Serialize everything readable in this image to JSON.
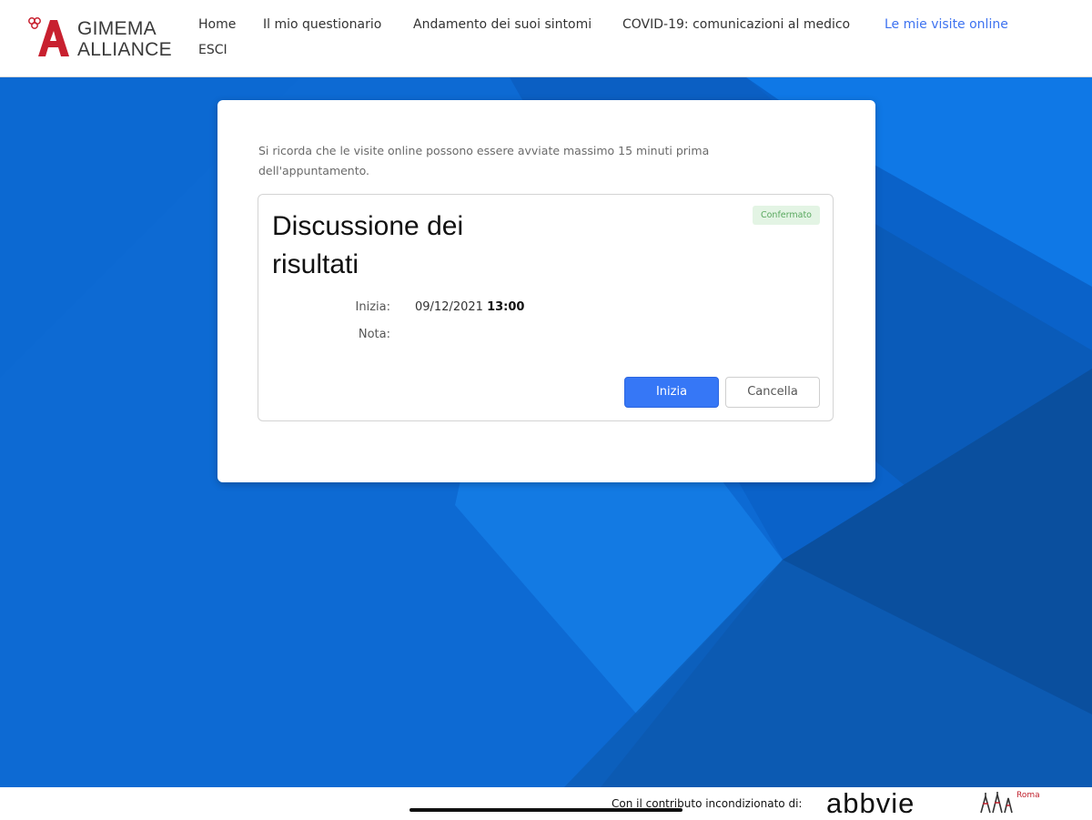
{
  "header": {
    "logo": {
      "line1": "GIMEMA",
      "line2": "ALLIANCE"
    },
    "nav": [
      {
        "label": "Home"
      },
      {
        "label": "Il mio questionario"
      },
      {
        "label": "Andamento dei suoi sintomi"
      },
      {
        "label": "COVID-19: comunicazioni al medico"
      },
      {
        "label": "Le mie visite online",
        "active": true
      },
      {
        "label": "ESCI"
      }
    ]
  },
  "card": {
    "reminder": "Si ricorda che le visite online possono essere avviate massimo 15 minuti prima dell'appuntamento.",
    "visit": {
      "title": "Discussione dei risultati",
      "status": "Confermato",
      "start_label": "Inizia:",
      "start_date": "09/12/2021",
      "start_time": "13:00",
      "note_label": "Nota:",
      "note_value": "",
      "start_button": "Inizia",
      "cancel_button": "Cancella"
    }
  },
  "footer": {
    "sponsor_text": "Con il contributo incondizionato di:",
    "sponsor_name": "abbvie",
    "partner_name": "Roma"
  },
  "colors": {
    "accent": "#3677f6",
    "nav_active": "#3d72f0",
    "hero_blue": "#0a62c9",
    "logo_red": "#c8202f",
    "status_green": "#58a85e"
  }
}
